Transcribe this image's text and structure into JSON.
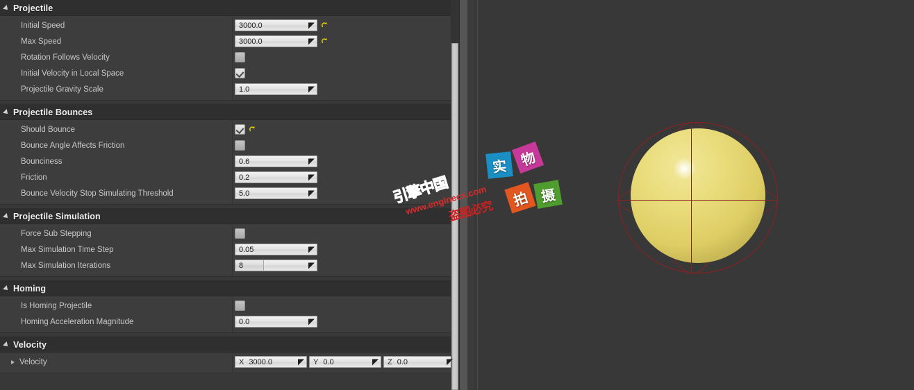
{
  "panel": {
    "name": "details-panel",
    "categories": [
      {
        "title": "Projectile",
        "rows": [
          {
            "label": "Initial Speed",
            "kind": "number",
            "value": "3000.0",
            "reset": true
          },
          {
            "label": "Max Speed",
            "kind": "number",
            "value": "3000.0",
            "reset": true
          },
          {
            "label": "Rotation Follows Velocity",
            "kind": "checkbox",
            "checked": false,
            "reset": false
          },
          {
            "label": "Initial Velocity in Local Space",
            "kind": "checkbox",
            "checked": true,
            "reset": false
          },
          {
            "label": "Projectile Gravity Scale",
            "kind": "number",
            "value": "1.0",
            "reset": false
          }
        ]
      },
      {
        "title": "Projectile Bounces",
        "rows": [
          {
            "label": "Should Bounce",
            "kind": "checkbox",
            "checked": true,
            "reset": true
          },
          {
            "label": "Bounce Angle Affects Friction",
            "kind": "checkbox",
            "checked": false,
            "reset": false
          },
          {
            "label": "Bounciness",
            "kind": "number",
            "value": "0.6",
            "reset": false
          },
          {
            "label": "Friction",
            "kind": "number",
            "value": "0.2",
            "reset": false
          },
          {
            "label": "Bounce Velocity Stop Simulating Threshold",
            "kind": "number",
            "value": "5.0",
            "reset": false
          }
        ]
      },
      {
        "title": "Projectile Simulation",
        "rows": [
          {
            "label": "Force Sub Stepping",
            "kind": "checkbox",
            "checked": false,
            "reset": false
          },
          {
            "label": "Max Simulation Time Step",
            "kind": "number",
            "value": "0.05",
            "reset": false
          },
          {
            "label": "Max Simulation Iterations",
            "kind": "slider",
            "value": "8",
            "reset": false
          }
        ]
      },
      {
        "title": "Homing",
        "rows": [
          {
            "label": "Is Homing Projectile",
            "kind": "checkbox",
            "checked": false,
            "reset": false
          },
          {
            "label": "Homing Acceleration Magnitude",
            "kind": "number",
            "value": "0.0",
            "reset": false
          }
        ]
      },
      {
        "title": "Velocity",
        "rows": [
          {
            "label": "Velocity",
            "kind": "vector",
            "expandable": true,
            "reset": true,
            "axes": [
              {
                "axis": "X",
                "value": "3000.0"
              },
              {
                "axis": "Y",
                "value": "0.0"
              },
              {
                "axis": "Z",
                "value": "0.0"
              }
            ]
          }
        ]
      }
    ],
    "scrollbar": {
      "name": "vertical-scrollbar"
    }
  },
  "viewport": {
    "name": "3d-viewport",
    "sphere_color": "#e4d66e",
    "wireframe_color": "#8e2020",
    "background_color": "#383838"
  },
  "watermark": {
    "brand_cn": "引擎中国",
    "url": "www.enginecx.com",
    "notice_cn": "盗图必究",
    "tiles": [
      {
        "char": "实",
        "color": "#1b8fc4"
      },
      {
        "char": "物",
        "color": "#c7389b"
      },
      {
        "char": "拍",
        "color": "#e2571f"
      },
      {
        "char": "摄",
        "color": "#4f9c2f"
      }
    ]
  }
}
